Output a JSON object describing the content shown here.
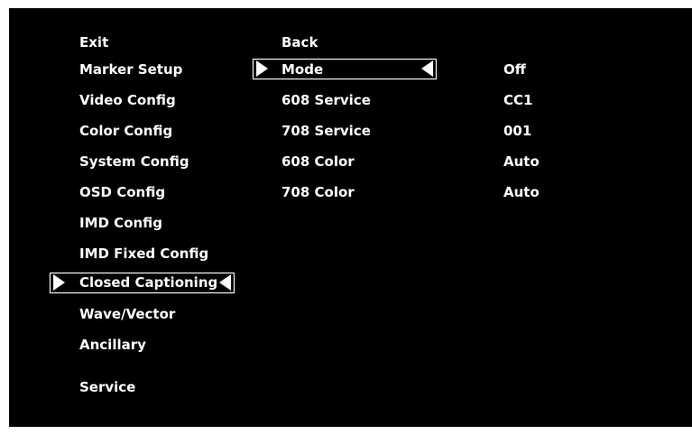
{
  "main_menu": {
    "items": [
      {
        "label": "Exit"
      },
      {
        "label": "Marker Setup"
      },
      {
        "label": "Video Config"
      },
      {
        "label": "Color Config"
      },
      {
        "label": "System Config"
      },
      {
        "label": "OSD Config"
      },
      {
        "label": "IMD Config"
      },
      {
        "label": "IMD Fixed Config"
      },
      {
        "label": "Closed Captioning",
        "selected": true
      },
      {
        "label": "Wave/Vector"
      },
      {
        "label": "Ancillary"
      },
      {
        "label": "Service"
      }
    ]
  },
  "sub_menu": {
    "items": [
      {
        "label": "Back",
        "value": ""
      },
      {
        "label": "Mode",
        "value": "Off",
        "selected": true
      },
      {
        "label": "608 Service",
        "value": "CC1"
      },
      {
        "label": "708 Service",
        "value": "001"
      },
      {
        "label": "608 Color",
        "value": "Auto"
      },
      {
        "label": "708 Color",
        "value": "Auto"
      }
    ]
  },
  "colors": {
    "background": "#000000",
    "text": "#ffffff",
    "selection_border": "#ffffff"
  },
  "icons": [
    "selection-arrow-right-icon",
    "selection-arrow-left-icon"
  ]
}
